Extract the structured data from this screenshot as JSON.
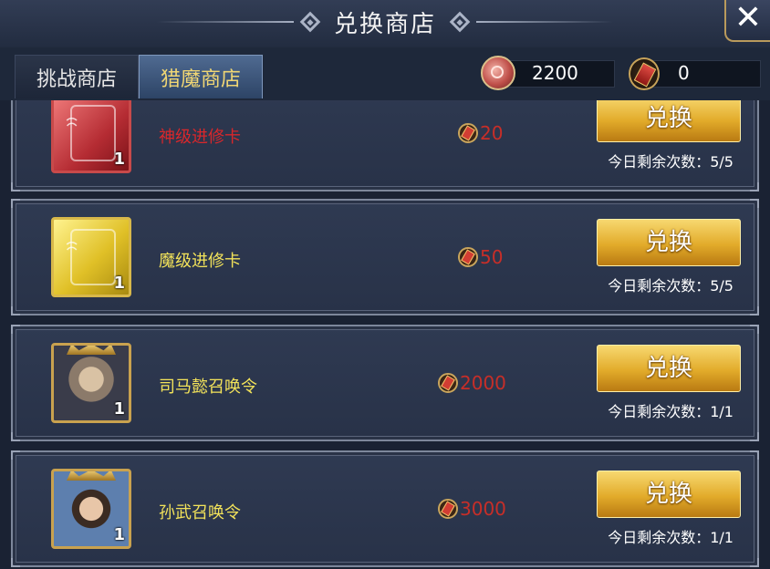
{
  "header": {
    "title": "兑换商店",
    "close_label": "✕"
  },
  "tabs": [
    {
      "label": "挑战商店",
      "active": false
    },
    {
      "label": "猎魔商店",
      "active": true
    }
  ],
  "currencies": [
    {
      "icon": "crimson-coin-icon",
      "value": "2200"
    },
    {
      "icon": "ticket-icon",
      "value": "0"
    }
  ],
  "items": [
    {
      "name": "神级进修卡",
      "name_color": "#d9272b",
      "quantity": "1",
      "price": "20",
      "button": "兑换",
      "limit": "今日剩余次数：5/5",
      "icon": "red-training-card-icon"
    },
    {
      "name": "魔级进修卡",
      "name_color": "#f3e35a",
      "quantity": "1",
      "price": "50",
      "button": "兑换",
      "limit": "今日剩余次数：5/5",
      "icon": "gold-training-card-icon"
    },
    {
      "name": "司马懿召唤令",
      "name_color": "#f3e35a",
      "quantity": "1",
      "price": "2000",
      "button": "兑换",
      "limit": "今日剩余次数：1/1",
      "icon": "sima-yi-portrait-icon"
    },
    {
      "name": "孙武召唤令",
      "name_color": "#f3e35a",
      "quantity": "1",
      "price": "3000",
      "button": "兑换",
      "limit": "今日剩余次数：1/1",
      "icon": "sun-wu-portrait-icon"
    }
  ]
}
